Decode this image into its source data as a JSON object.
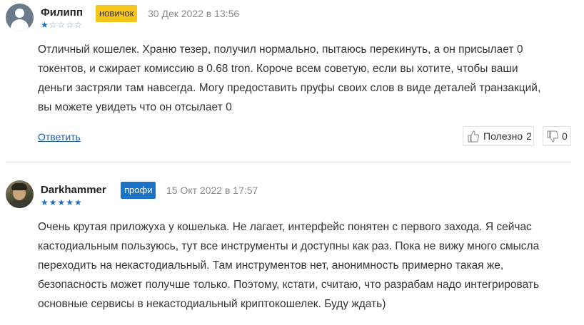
{
  "reviews": [
    {
      "author": "Филипп",
      "badge": "новичок",
      "date": "30 Дек 2022 в 13:56",
      "rating": 1,
      "text_lines": [
        "Отличный кошелек. Храню тезер, получил нормально, пытаюсь перекинуть, а он присылает 0",
        "токентов, и сжирает комиссию в 0.68 tron. Короче всем советую, если вы хотите, чтобы ваши",
        "деньги застряли там навсегда. Могу предоставить пруфы своих слов в виде деталей транзакций,",
        "вы можете увидеть что он отсылает 0"
      ],
      "reply_label": "Ответить",
      "helpful_label": "Полезно",
      "helpful_count": "2",
      "unhelpful_count": "0"
    },
    {
      "author": "Darkhammer",
      "badge": "профи",
      "date": "15 Окт 2022 в 17:57",
      "rating": 5,
      "text_lines": [
        "Очень крутая приложуха у кошелька. Не лагает, интерфейс понятен с первого захода. Я сейчас",
        "кастодиальным пользуюсь, тут все инструменты и доступны как раз. Пока не вижу много смысла",
        "переходить на некастодиальный. Там инструментов нет, анонимность примерно такая же,",
        "безопасность может получше только. Поэтому, кстати, считаю, что разрабам надо интегрировать",
        "основные сервисы в некастодиальный криптокошелек. Буду ждать)"
      ]
    }
  ],
  "colors": {
    "novice_badge": "#f5c518",
    "pro_badge": "#1a73c7",
    "star": "#1a73c7",
    "link": "#1a5ea8"
  }
}
